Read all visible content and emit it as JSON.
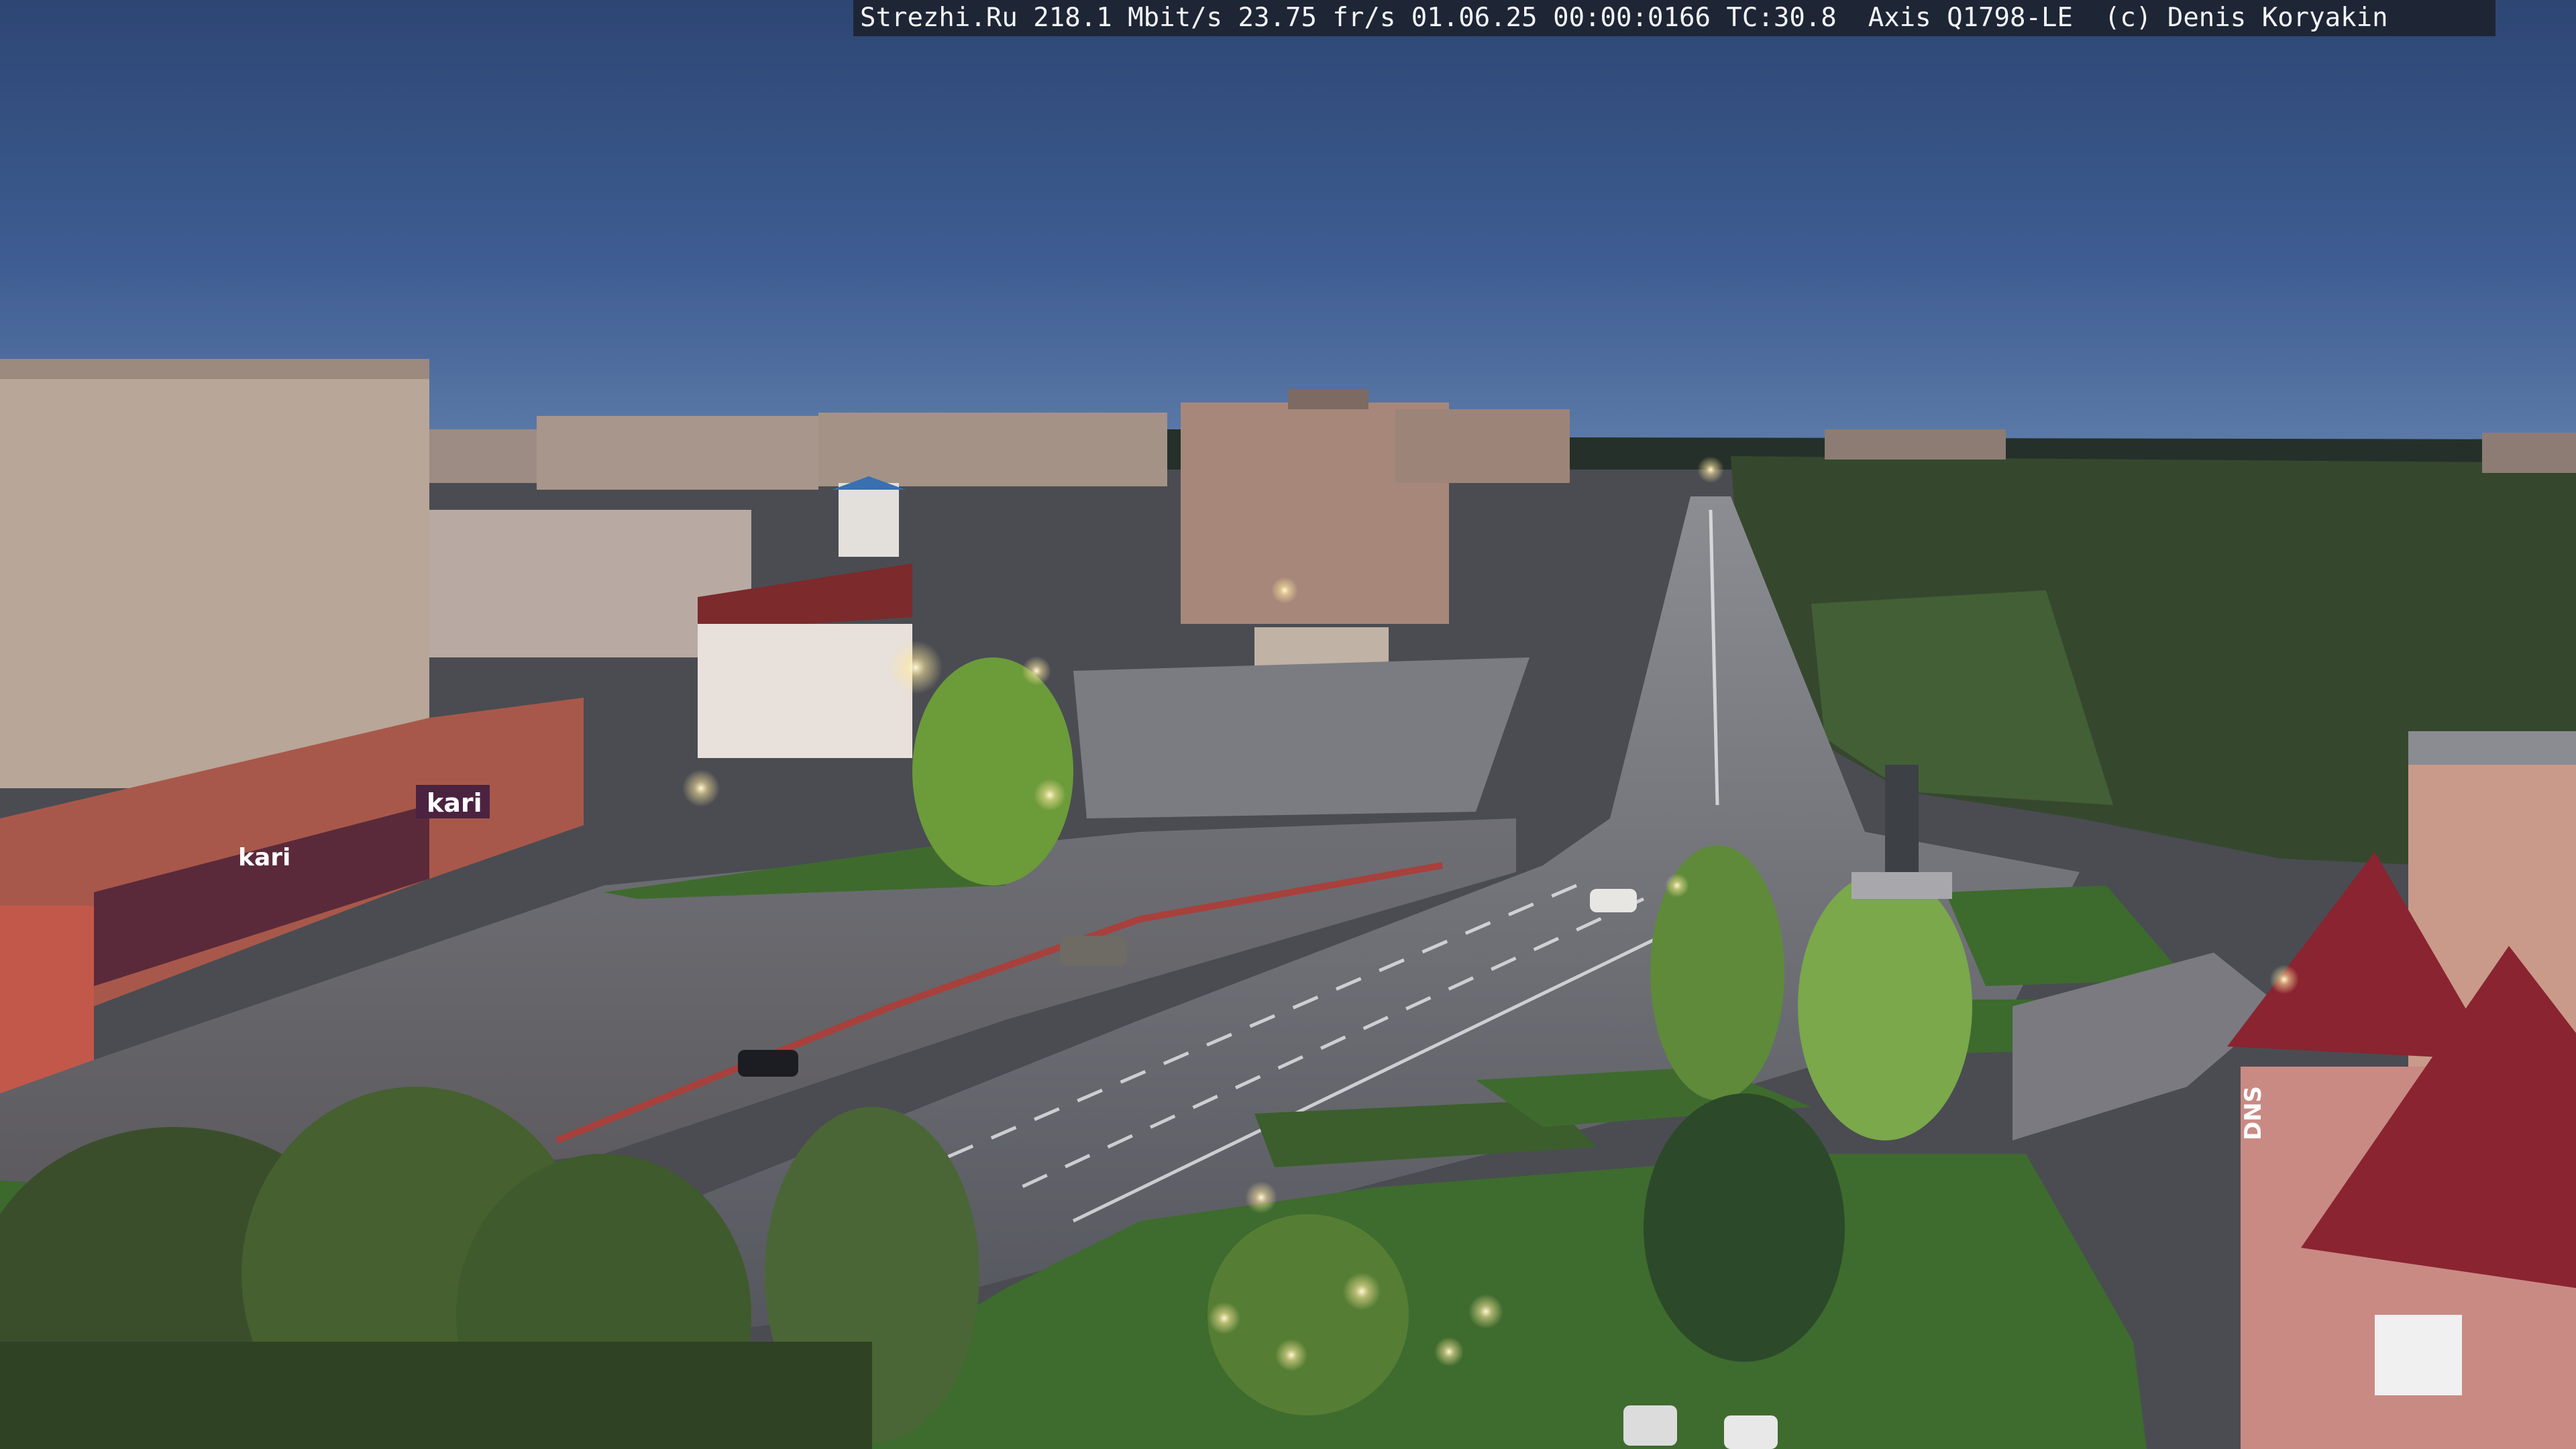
{
  "camera_overlay": {
    "text": "Strezhi.Ru 218.1 Mbit/s 23.75 fr/s 01.06.25 00:00:0166 TC:30.8  Axis Q1798-LE  (c) Denis Koryakin"
  },
  "signs": {
    "store_main": "kari",
    "store_left": "kari",
    "shop_bottom_right": "DNS"
  },
  "colors": {
    "sky_top": "#2f4a78",
    "sky_horizon": "#5474a6",
    "grass": "#3e6b2e",
    "road": "#5d5f66",
    "street_light": "#fff6d2",
    "roof_red": "#8a2430"
  }
}
